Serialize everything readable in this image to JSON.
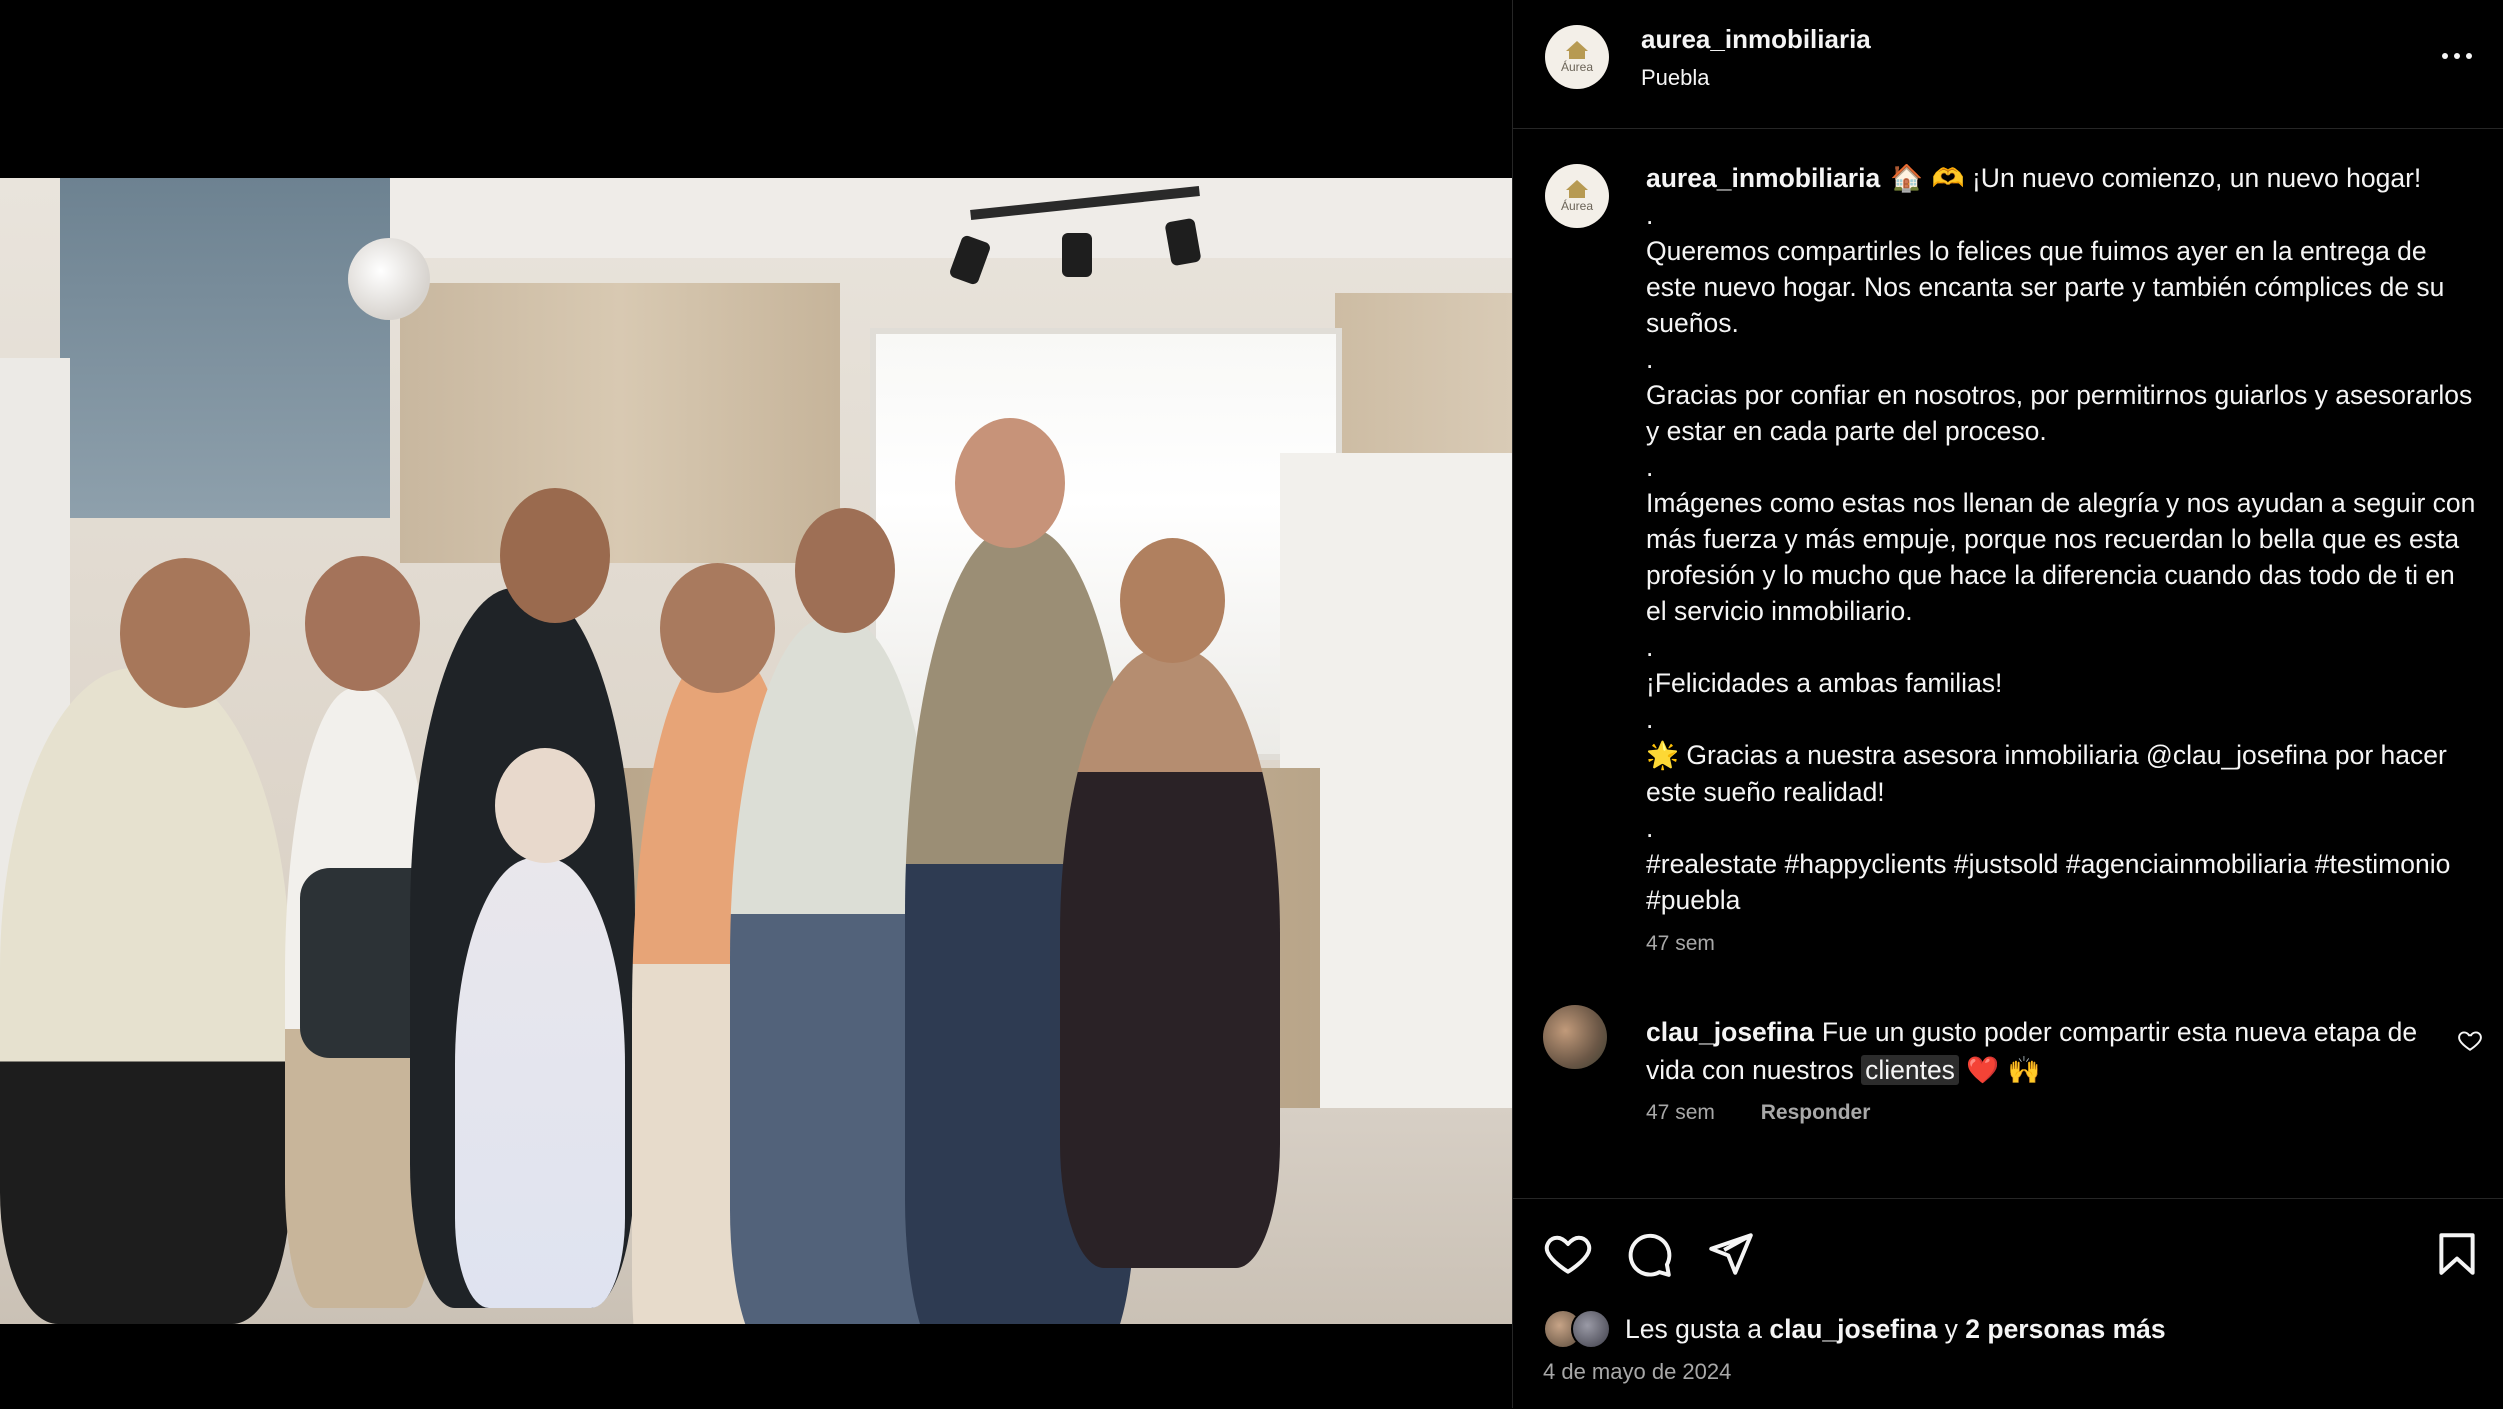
{
  "post": {
    "username": "aurea_inmobiliaria",
    "location": "Puebla",
    "avatar_brand": "Áurea",
    "photo_alt": ""
  },
  "caption": {
    "username": "aurea_inmobiliaria",
    "emojis": "🏠 🫶",
    "line1": "¡Un nuevo comienzo, un nuevo hogar!",
    "dot": ".",
    "para1": "Queremos compartirles lo felices que fuimos ayer en la entrega de este nuevo hogar. Nos encanta ser parte y también cómplices de su sueños.",
    "para2": "Gracias por confiar en nosotros, por permitirnos guiarlos y asesorarlos y estar en cada parte del proceso.",
    "para3": "Imágenes como estas nos llenan de alegría y nos ayudan a seguir con más fuerza y más empuje, porque nos recuerdan lo bella que es esta profesión y lo mucho que hace la diferencia cuando das todo de ti en el servicio inmobiliario.",
    "para4": "¡Felicidades a ambas familias!",
    "sun_emoji": "🌟",
    "para5_prefix": "Gracias a nuestra asesora inmobiliaria ",
    "mention": "@clau_josefina",
    "para5_suffix": " por hacer este sueño realidad!",
    "hashtags": "#realestate #happyclients #justsold #agenciainmobiliaria #testimonio #puebla",
    "time": "47 sem"
  },
  "comment": {
    "username": "clau_josefina",
    "text_before": "Fue un gusto poder compartir esta nueva etapa de vida con nuestros ",
    "highlighted": "clientes",
    "emojis": "❤️ 🙌",
    "time": "47 sem",
    "reply_label": "Responder"
  },
  "likes": {
    "prefix": "Les gusta a ",
    "user": "clau_josefina",
    "middle": " y ",
    "others": "2 personas más"
  },
  "date": "4 de mayo de 2024"
}
